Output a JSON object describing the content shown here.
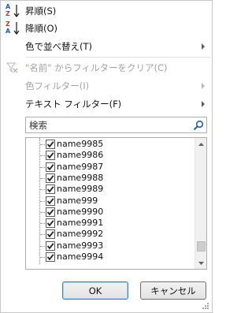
{
  "menu": {
    "sort_asc": {
      "label": "昇順(S)",
      "icon_top": "A",
      "icon_bottom": "Z",
      "icon": "sort-ascending-icon"
    },
    "sort_desc": {
      "label": "降順(O)",
      "icon_top": "Z",
      "icon_bottom": "A",
      "icon": "sort-descending-icon"
    },
    "sort_by_color": {
      "label": "色で並べ替え(T)"
    },
    "clear_filter": {
      "label": "\"名前\" からフィルターをクリア(C)",
      "icon": "clear-filter-icon"
    },
    "color_filter": {
      "label": "色フィルター(I)"
    },
    "text_filter": {
      "label": "テキスト フィルター(F)"
    }
  },
  "search": {
    "placeholder": "検索",
    "icon": "search-icon"
  },
  "list": {
    "items": [
      {
        "label": "name9985",
        "checked": true
      },
      {
        "label": "name9986",
        "checked": true
      },
      {
        "label": "name9987",
        "checked": true
      },
      {
        "label": "name9988",
        "checked": true
      },
      {
        "label": "name9989",
        "checked": true
      },
      {
        "label": "name999",
        "checked": true
      },
      {
        "label": "name9990",
        "checked": true
      },
      {
        "label": "name9991",
        "checked": true
      },
      {
        "label": "name9992",
        "checked": true
      },
      {
        "label": "name9993",
        "checked": true
      },
      {
        "label": "name9994",
        "checked": true
      }
    ]
  },
  "buttons": {
    "ok": "OK",
    "cancel": "キャンセル"
  },
  "colors": {
    "accent_blue": "#1e5ea8",
    "disabled_text": "#a3a3a3"
  }
}
